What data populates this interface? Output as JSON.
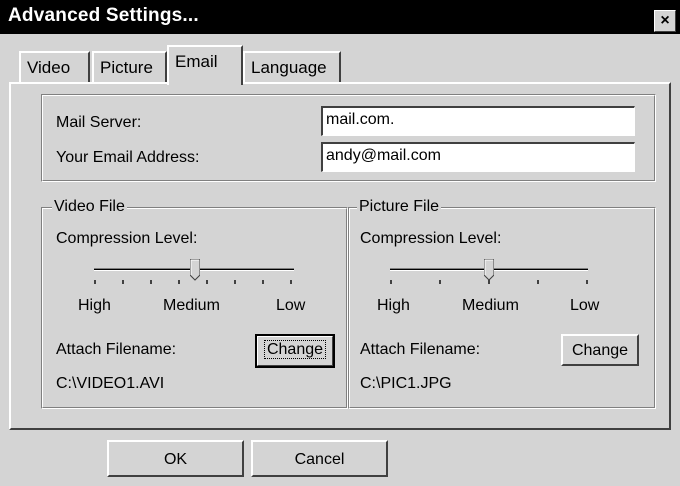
{
  "window": {
    "title": "Advanced Settings...",
    "close_label": "×"
  },
  "tabs": [
    {
      "label": "Video"
    },
    {
      "label": "Picture"
    },
    {
      "label": "Email",
      "active": true
    },
    {
      "label": "Language"
    }
  ],
  "server": {
    "mail_server_label": "Mail Server:",
    "mail_server_value": "mail.com.",
    "email_label": "Your Email Address:",
    "email_value": "andy@mail.com"
  },
  "video_file": {
    "legend": "Video File",
    "compression_label": "Compression Level:",
    "slider": {
      "ticks": [
        "High",
        "Medium",
        "Low"
      ],
      "level": "Medium",
      "position_fraction": 0.5
    },
    "attach_label": "Attach Filename:",
    "change_label": "Change",
    "filename": "C:\\VIDEO1.AVI"
  },
  "picture_file": {
    "legend": "Picture File",
    "compression_label": "Compression Level:",
    "slider": {
      "ticks": [
        "High",
        "Medium",
        "Low"
      ],
      "level": "Medium",
      "position_fraction": 0.5
    },
    "attach_label": "Attach Filename:",
    "change_label": "Change",
    "filename": "C:\\PIC1.JPG"
  },
  "footer": {
    "ok_label": "OK",
    "cancel_label": "Cancel"
  },
  "colors": {
    "title_bg": "#000000",
    "dialog_bg": "#d4d4d4"
  },
  "icons": {
    "close": "close-icon"
  }
}
